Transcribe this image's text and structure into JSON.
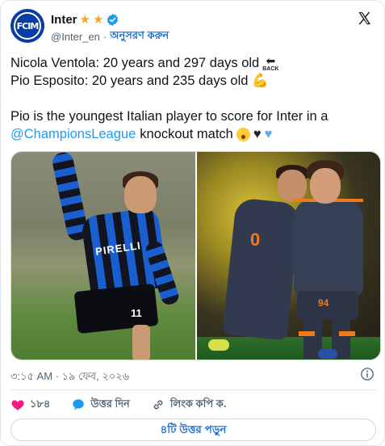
{
  "account": {
    "display_name": "Inter",
    "stars": [
      "★",
      "★"
    ],
    "handle": "@Inter_en",
    "separator": "·",
    "follow_label": "অনুসরণ করুন",
    "avatar_text": "FCIM"
  },
  "tweet": {
    "line1": "Nicola Ventola: 20 years and 297 days old",
    "line2": "Pio Esposito: 20 years and 235 days old",
    "line3": "Pio is the youngest Italian player to score for Inter in a",
    "mention": "@ChampionsLeague",
    "line4_tail": "knockout match",
    "back_emoji_arrow": "⬅",
    "back_emoji_word": "BACK",
    "flex_emoji": "💪",
    "black_heart": "♥",
    "blue_heart": "♥"
  },
  "media": {
    "left_sponsor": "PIRELLI",
    "left_number": "11",
    "right_number_1": "0",
    "right_number_2": "94"
  },
  "footer": {
    "timestamp": "৩:১৫ AM · ১৯ ফেব, ২০২৬",
    "like_count": "১৮৪",
    "reply_label": "উত্তর দিন",
    "copy_link_label": "লিংক কপি ক.",
    "read_replies_label": "৪টি উত্তর পড়ুন"
  },
  "colors": {
    "accent_blue": "#1d9bf0",
    "follow_blue": "#1d6fd1",
    "like_pink": "#f91880",
    "star_gold": "#f5a623",
    "avatar_blue": "#0a3da3"
  }
}
